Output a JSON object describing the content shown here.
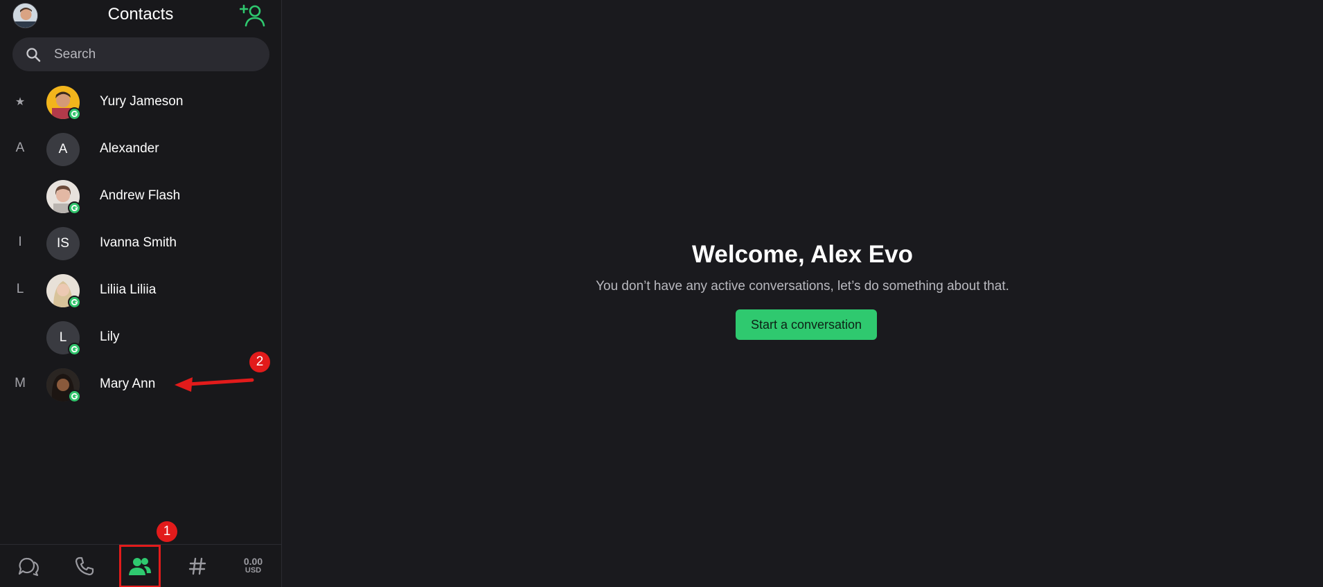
{
  "sidebar": {
    "title": "Contacts",
    "search": {
      "placeholder": "Search",
      "value": ""
    },
    "contacts": [
      {
        "group": "★",
        "name": "Yury Jameson",
        "initials": "",
        "online": true
      },
      {
        "group": "A",
        "name": "Alexander",
        "initials": "A",
        "online": false
      },
      {
        "group": "",
        "name": "Andrew Flash",
        "initials": "",
        "online": true
      },
      {
        "group": "I",
        "name": "Ivanna Smith",
        "initials": "IS",
        "online": false
      },
      {
        "group": "L",
        "name": "Liliia Liliia",
        "initials": "",
        "online": true
      },
      {
        "group": "",
        "name": "Lily",
        "initials": "L",
        "online": true
      },
      {
        "group": "M",
        "name": "Mary Ann",
        "initials": "",
        "online": true
      }
    ]
  },
  "bottom_nav": {
    "items": [
      "chats-icon",
      "phone-icon",
      "contacts-icon",
      "channels-icon"
    ],
    "balance_amount": "0.00",
    "balance_currency": "USD"
  },
  "main": {
    "welcome": "Welcome, Alex Evo",
    "subtitle": "You don’t have any active conversations, let’s do something about that.",
    "start_button": "Start a conversation"
  },
  "annotations": {
    "step1": "1",
    "step2": "2"
  },
  "colors": {
    "accent": "#2fc96f",
    "annotation": "#e21b1b",
    "background": "#19191d"
  }
}
